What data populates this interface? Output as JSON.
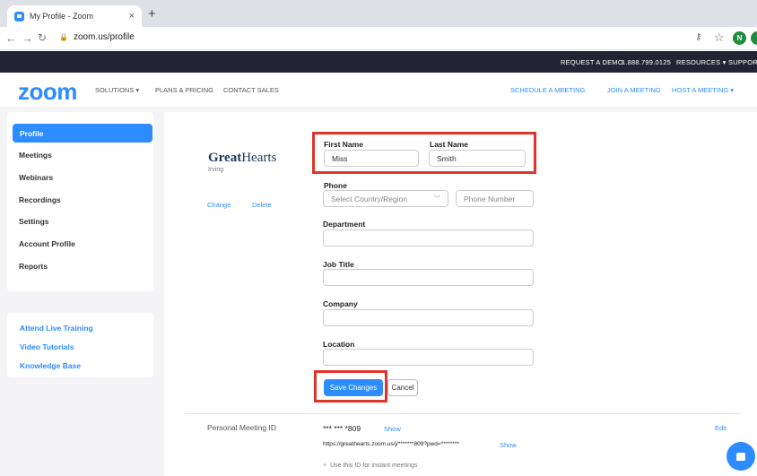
{
  "browser": {
    "tab_title": "My Profile - Zoom",
    "tab_close": "×",
    "new_tab": "+",
    "url": "zoom.us/profile",
    "profile_initial": "N"
  },
  "topstrip": {
    "request_demo": "REQUEST A DEMO",
    "phone": "1.888.799.0125",
    "resources": "RESOURCES ▾",
    "support": "SUPPORT"
  },
  "header": {
    "logo": "zoom",
    "solutions": "SOLUTIONS ▾",
    "plans": "PLANS & PRICING",
    "contact": "CONTACT SALES",
    "schedule": "SCHEDULE A MEETING",
    "join": "JOIN A MEETING",
    "host": "HOST A MEETING ▾"
  },
  "sidebar": {
    "items": [
      "Profile",
      "Meetings",
      "Webinars",
      "Recordings",
      "Settings",
      "Account Profile",
      "Reports"
    ],
    "links": [
      "Attend Live Training",
      "Video Tutorials",
      "Knowledge Base"
    ]
  },
  "profile_pic": {
    "brand_bold": "Great",
    "brand_rest": "Hearts",
    "sub": "Irving",
    "change": "Change",
    "delete": "Delete"
  },
  "form": {
    "first_name_label": "First Name",
    "first_name_value": "Miss",
    "last_name_label": "Last Name",
    "last_name_value": "Smith",
    "phone_label": "Phone",
    "country_placeholder": "Select Country/Region",
    "phone_placeholder": "Phone Number",
    "department_label": "Department",
    "job_title_label": "Job Title",
    "company_label": "Company",
    "location_label": "Location",
    "save": "Save Changes",
    "cancel": "Cancel"
  },
  "pmi": {
    "label": "Personal Meeting ID",
    "value": "*** *** *809",
    "show": "Show",
    "edit": "Edit",
    "url": "https://greathearts.zoom.us/j/*******809?pwd=********",
    "url_show": "Show",
    "instant": "Use this ID for instant meetings"
  },
  "colors": {
    "accent": "#2d8cff",
    "highlight": "#e0332a",
    "topstrip": "#232333"
  }
}
